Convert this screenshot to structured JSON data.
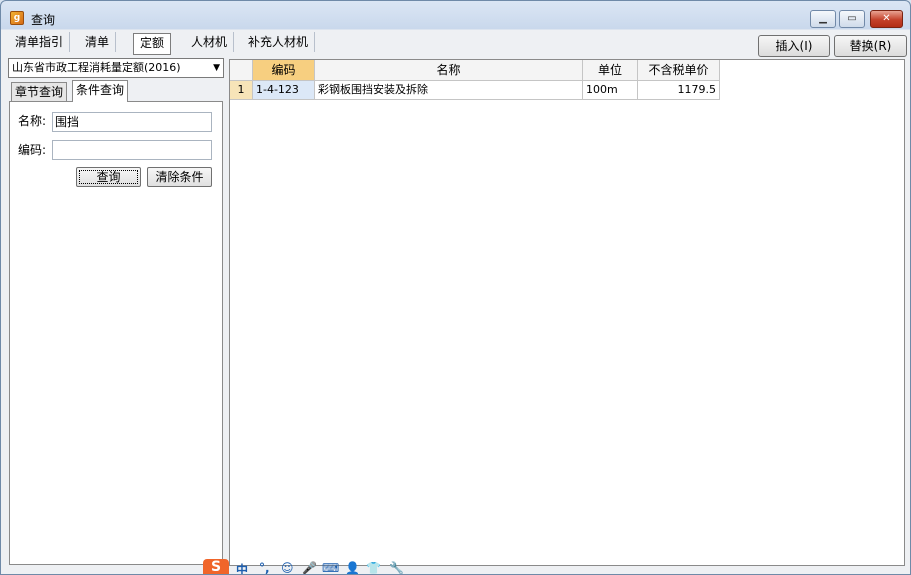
{
  "window": {
    "title": "查询",
    "icon": "app-icon"
  },
  "tabs": [
    {
      "label": "清单指引"
    },
    {
      "label": "清单"
    },
    {
      "label": "定额",
      "active": true
    },
    {
      "label": "人材机"
    },
    {
      "label": "补充人材机"
    }
  ],
  "actions": {
    "insert_label": "插入(I)",
    "replace_label": "替换(R)"
  },
  "left": {
    "quota_select": "山东省市政工程消耗量定额(2016)",
    "subtabs": [
      {
        "label": "章节查询"
      },
      {
        "label": "条件查询",
        "active": true
      }
    ],
    "form": {
      "name_label": "名称:",
      "name_value": "围挡",
      "code_label": "编码:",
      "code_value": "",
      "query_label": "查询",
      "clear_label": "清除条件"
    }
  },
  "grid": {
    "columns": [
      "",
      "编码",
      "名称",
      "单位",
      "不含税单价"
    ],
    "rows": [
      {
        "num": "1",
        "code": "1-4-123",
        "name": "彩钢板围挡安装及拆除",
        "unit": "100m",
        "price": "1179.5"
      }
    ]
  },
  "ime": {
    "logo": "S",
    "items": [
      "中",
      "°,",
      "☺",
      "🎤",
      "⌨",
      "👤",
      "👕",
      "🔧"
    ]
  },
  "colors": {
    "header_selected": "#f7cf80",
    "row_number": "#f7e4b8",
    "close_button": "#c4412a"
  }
}
